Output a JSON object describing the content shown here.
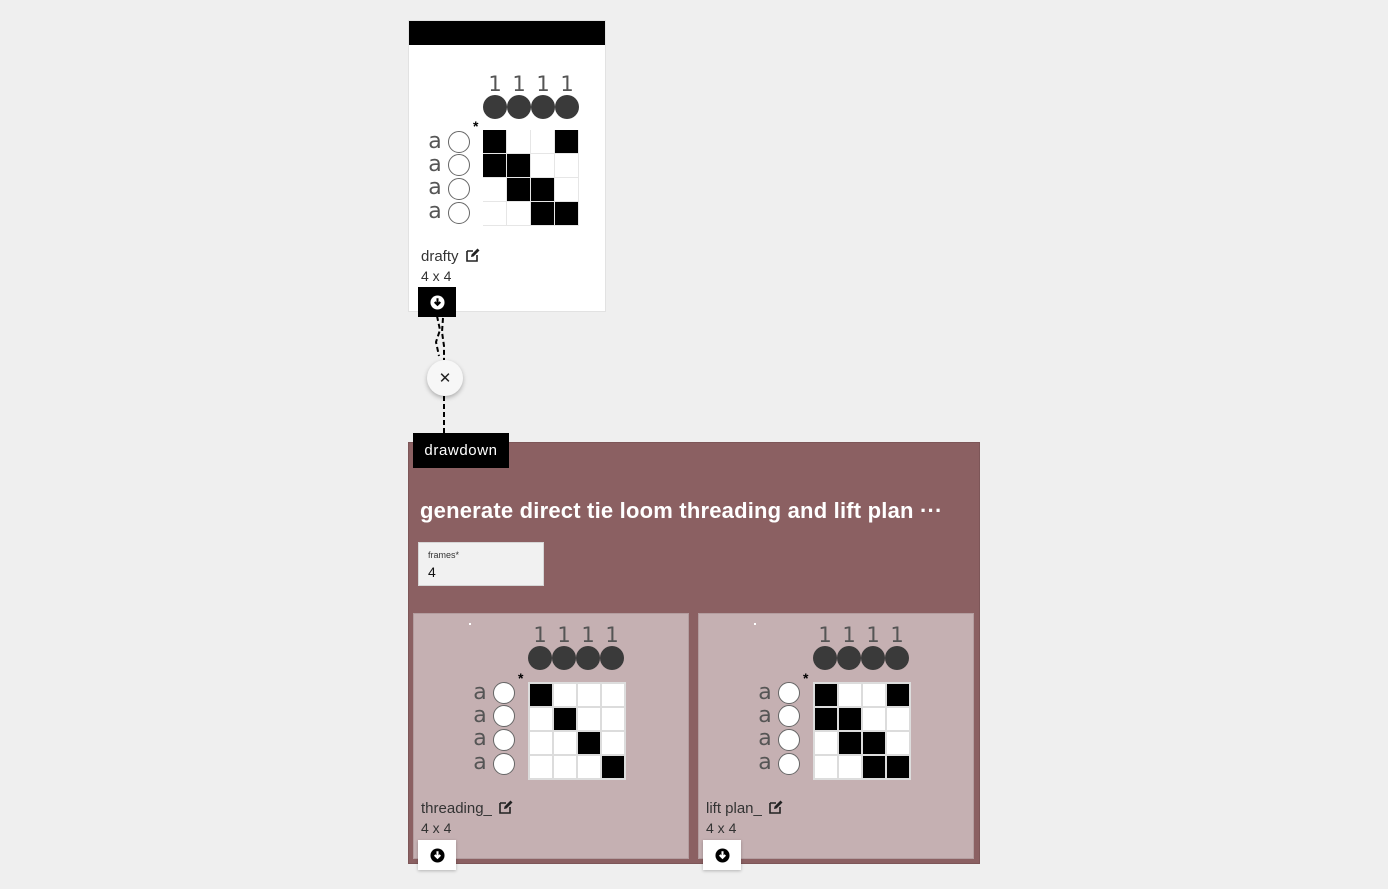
{
  "draft": {
    "warp_numbers": [
      "1",
      "1",
      "1",
      "1"
    ],
    "weft_letters": [
      "a",
      "a",
      "a",
      "a"
    ],
    "first_marker": "*",
    "cells": [
      [
        1,
        0,
        0,
        1
      ],
      [
        1,
        1,
        0,
        0
      ],
      [
        0,
        1,
        1,
        0
      ],
      [
        0,
        0,
        1,
        1
      ]
    ],
    "name": "drafty",
    "size": "4 x 4",
    "edit_icon": "edit-icon",
    "download_icon": "download-icon"
  },
  "connector": {
    "close_label": "✕"
  },
  "operation": {
    "tag": "drawdown",
    "title": "generate direct tie loom threading and lift plan ···",
    "param": {
      "label": "frames*",
      "value": "4"
    },
    "color": "#8b6062"
  },
  "outputs": [
    {
      "name": "threading_",
      "size": "4 x 4",
      "warp_numbers": [
        "1",
        "1",
        "1",
        "1"
      ],
      "weft_letters": [
        "a",
        "a",
        "a",
        "a"
      ],
      "first_marker": "*",
      "cells": [
        [
          1,
          0,
          0,
          0
        ],
        [
          0,
          1,
          0,
          0
        ],
        [
          0,
          0,
          1,
          0
        ],
        [
          0,
          0,
          0,
          1
        ]
      ]
    },
    {
      "name": "lift plan_",
      "size": "4 x 4",
      "warp_numbers": [
        "1",
        "1",
        "1",
        "1"
      ],
      "weft_letters": [
        "a",
        "a",
        "a",
        "a"
      ],
      "first_marker": "*",
      "cells": [
        [
          1,
          0,
          0,
          1
        ],
        [
          1,
          1,
          0,
          0
        ],
        [
          0,
          1,
          1,
          0
        ],
        [
          0,
          0,
          1,
          1
        ]
      ]
    }
  ]
}
